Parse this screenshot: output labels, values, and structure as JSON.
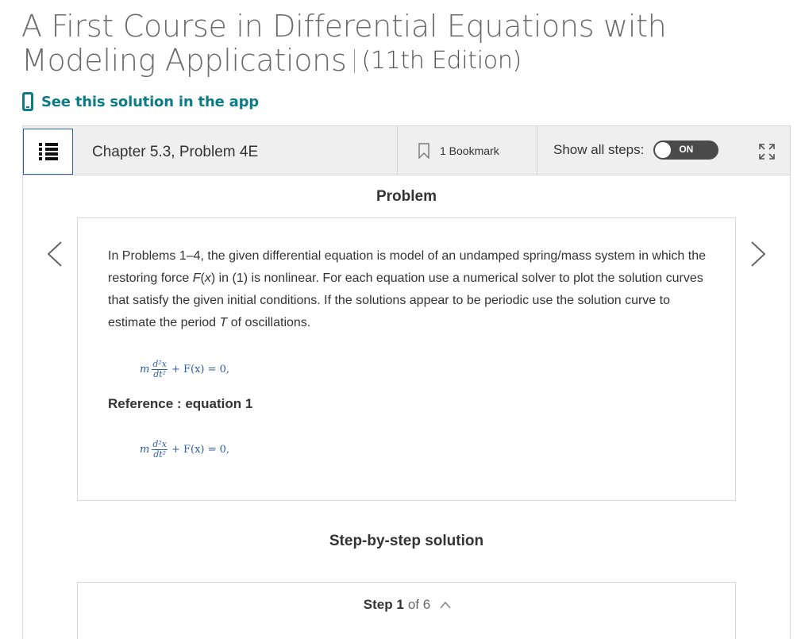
{
  "book": {
    "title_line1": "A First Course in Differential Equations with",
    "title_line2": "Modeling Applications",
    "edition": "(11th Edition)"
  },
  "app_link": {
    "label": "See this solution in the app",
    "icon": "phone-icon"
  },
  "toolbar": {
    "toc_icon": "list-icon",
    "chapter": "Chapter 5.3, Problem 4E",
    "bookmark_label": "1 Bookmark",
    "show_all_steps_label": "Show all steps:",
    "toggle_state": "ON",
    "expand_icon": "expand-icon"
  },
  "problem": {
    "heading": "Problem",
    "text_part1": "In Problems 1–4, the given differential equation is model of an undamped spring/mass system in which the restoring force ",
    "fx": "F",
    "text_part2": "(",
    "x_var": "x",
    "text_part3": ") in (1) is nonlinear. For each equation use a numerical solver to plot the solution curves that satisfy the given initial conditions. If the solutions appear to be periodic use the solution curve to estimate the period ",
    "T": "T",
    "text_part4": " of oscillations.",
    "equation": {
      "m": "m",
      "num": "d²x",
      "den": "dt²",
      "rest": "+ F(x) = 0,"
    },
    "reference": "Reference : equation 1"
  },
  "solution": {
    "heading": "Step-by-step solution",
    "step_word": "Step 1",
    "step_of": "of 6"
  },
  "colors": {
    "accent": "#0e7c86",
    "equation": "#2d5ea8",
    "toggle_bg": "#4a4a4a",
    "toc_border": "#2f5fa8"
  }
}
